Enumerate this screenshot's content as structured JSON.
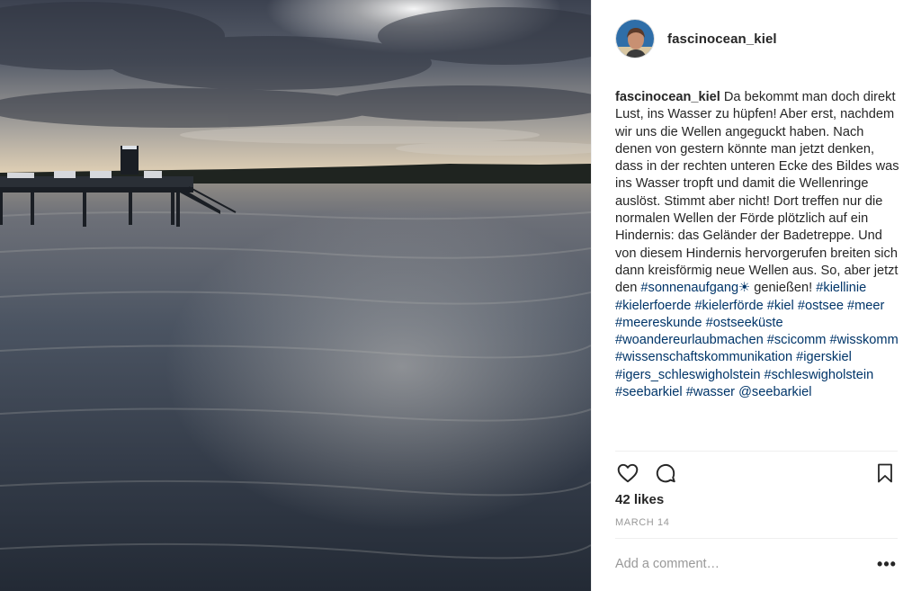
{
  "post": {
    "username": "fascinocean_kiel",
    "caption": {
      "username": "fascinocean_kiel",
      "text_before": " Da bekommt man doch direkt Lust, ins Wasser zu hüpfen! Aber erst, nachdem wir uns die Wellen angeguckt haben. Nach denen von gestern könnte man jetzt denken, dass in der rechten unteren Ecke des Bildes was ins Wasser tropft und damit die Wellenringe auslöst. Stimmt aber nicht! Dort treffen nur die normalen Wellen der Förde plötzlich auf ein Hindernis: das Geländer der Badetreppe. Und von diesem Hindernis hervorgerufen breiten sich dann kreisförmig neue Wellen aus. So, aber jetzt den ",
      "first_tag": "#sonnenaufgang☀",
      "text_after_first_tag": " genießen! ",
      "hashtags": [
        "#kiellinie",
        "#kielerfoerde",
        "#kielerförde",
        "#kiel",
        "#ostsee",
        "#meer",
        "#meereskunde",
        "#ostseeküste",
        "#woandereurlaubmachen",
        "#scicomm",
        "#wisskomm",
        "#wissenschaftskommunikation",
        "#igerskiel",
        "#igers_schleswigholstein",
        "#schleswigholstein",
        "#seebarkiel",
        "#wasser",
        "@seebarkiel"
      ]
    },
    "likes": "42 likes",
    "date": "MARCH 14",
    "comment_placeholder": "Add a comment…",
    "more_label": "•••"
  },
  "icons": {
    "like": "heart-icon",
    "comment": "comment-bubble-icon",
    "save": "bookmark-icon",
    "more": "more-options-icon"
  },
  "colors": {
    "hashtag": "#003569",
    "text": "#262626",
    "muted": "#999999",
    "divider": "#efefef"
  }
}
